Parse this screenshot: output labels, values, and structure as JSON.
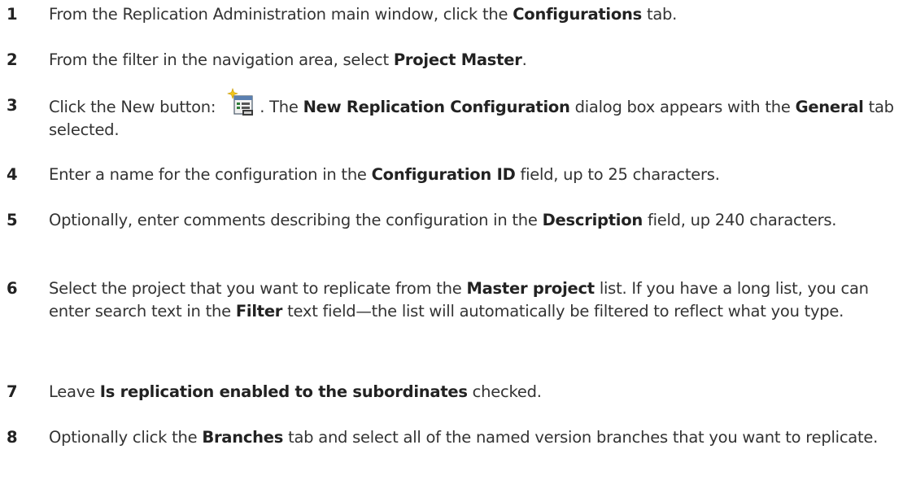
{
  "steps": [
    {
      "number": "1",
      "parts": [
        "From the Replication Administration main window, click the ",
        "Configurations",
        " tab."
      ]
    },
    {
      "number": "2",
      "parts": [
        "From the filter in the navigation area, select ",
        "Project Master",
        "."
      ]
    },
    {
      "number": "3",
      "parts": [
        "Click the New button: ",
        ". The ",
        "New Replication Configuration",
        " dialog box appears with the ",
        "General",
        " tab selected."
      ],
      "icon": "new-configuration-icon"
    },
    {
      "number": "4",
      "parts": [
        "Enter a name for the configuration in the ",
        "Configuration ID",
        " field, up to 25 characters."
      ]
    },
    {
      "number": "5",
      "parts": [
        "Optionally, enter comments describing the configuration in the ",
        "Description",
        " field, up 240 characters."
      ]
    },
    {
      "number": "6",
      "parts": [
        "Select the project that you want to replicate from the ",
        "Master project",
        " list. If you have a long list, you can enter search text in the ",
        "Filter",
        " text field—the list will automatically be filtered to reflect what you type."
      ]
    },
    {
      "number": "7",
      "parts": [
        "Leave ",
        "Is replication enabled to the subordinates",
        " checked."
      ]
    },
    {
      "number": "8",
      "parts": [
        "Optionally click the ",
        "Branches",
        " tab and select all of the named version branches that you want to replicate."
      ]
    }
  ]
}
